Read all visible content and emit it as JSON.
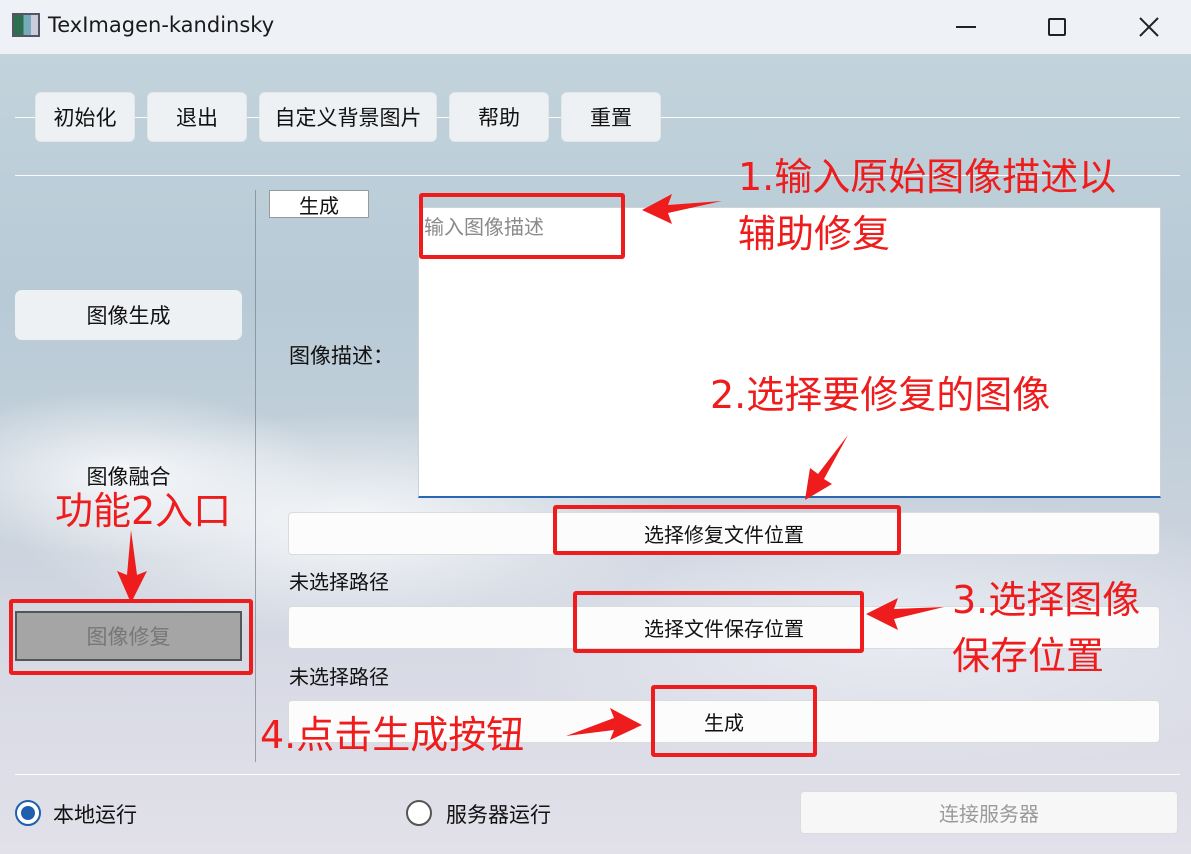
{
  "window": {
    "title": "TexImagen-kandinsky"
  },
  "toolbar": {
    "init": "初始化",
    "exit": "退出",
    "custom_bg": "自定义背景图片",
    "help": "帮助",
    "reset": "重置"
  },
  "sidebar": {
    "items": [
      {
        "label": "图像生成"
      },
      {
        "label": "图像融合"
      },
      {
        "label": "图像修复"
      }
    ]
  },
  "main": {
    "tab_label": "生成",
    "desc_label": "图像描述：",
    "desc_placeholder": "输入图像描述",
    "select_fix_button": "选择修复文件位置",
    "fix_path": "未选择路径",
    "select_save_button": "选择文件保存位置",
    "save_path": "未选择路径",
    "generate_button": "生成"
  },
  "footer": {
    "local_run": "本地运行",
    "server_run": "服务器运行",
    "connect_button": "连接服务器",
    "selected_mode": "本地运行"
  },
  "annotations": {
    "step1_line1": "1.输入原始图像描述以",
    "step1_line2": "辅助修复",
    "step2": "2.选择要修复的图像",
    "step3_line1": "3.选择图像",
    "step3_line2": "保存位置",
    "step4": "4.点击生成按钮",
    "entry": "功能2入口",
    "color": "#ee1c1c"
  }
}
